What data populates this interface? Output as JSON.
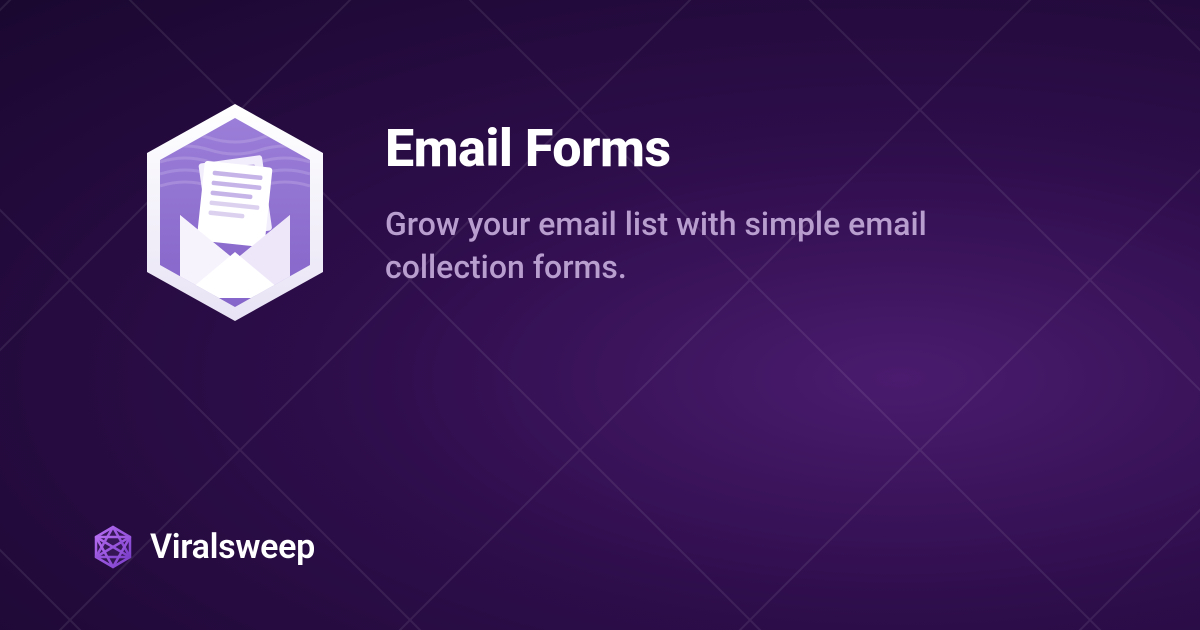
{
  "hero": {
    "title": "Email Forms",
    "subtitle": "Grow your email list with simple email collection forms."
  },
  "brand": {
    "name": "Viralsweep"
  },
  "colors": {
    "accent": "#a855f7",
    "text_primary": "#ffffff",
    "text_secondary": "#b89dcf"
  }
}
